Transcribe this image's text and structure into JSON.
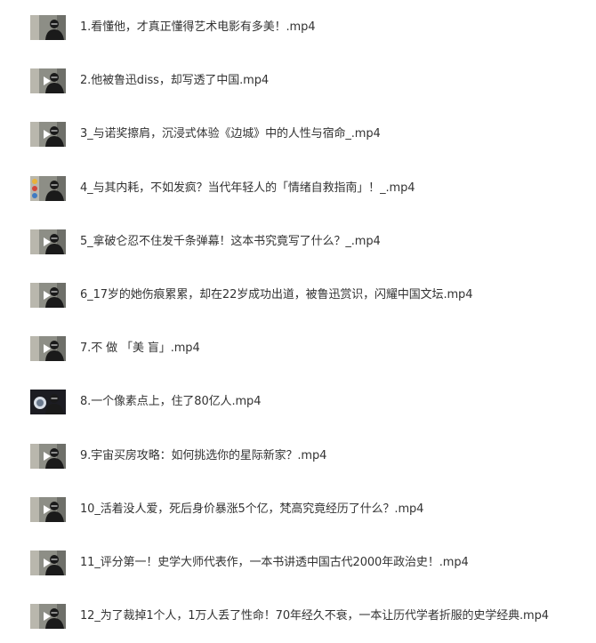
{
  "files": [
    {
      "name": "1.看懂他，才真正懂得艺术电影有多美！.mp4",
      "thumb_style": "standard",
      "has_play_icon": false
    },
    {
      "name": "2.他被鲁迅diss，却写透了中国.mp4",
      "thumb_style": "standard",
      "has_play_icon": true
    },
    {
      "name": "3_与诺奖擦肩，沉浸式体验《边城》中的人性与宿命_.mp4",
      "thumb_style": "standard",
      "has_play_icon": true
    },
    {
      "name": "4_与其内耗，不如发疯？当代年轻人的「情绪自救指南」！_.mp4",
      "thumb_style": "colorful",
      "has_play_icon": false
    },
    {
      "name": "5_拿破仑忍不住发千条弹幕！这本书究竟写了什么？_.mp4",
      "thumb_style": "standard",
      "has_play_icon": true
    },
    {
      "name": "6_17岁的她伤痕累累，却在22岁成功出道，被鲁迅赏识，闪耀中国文坛.mp4",
      "thumb_style": "standard",
      "has_play_icon": true
    },
    {
      "name": "7.不 做 「美 盲」.mp4",
      "thumb_style": "standard",
      "has_play_icon": true
    },
    {
      "name": "8.一个像素点上，住了80亿人.mp4",
      "thumb_style": "dark",
      "has_play_icon": false
    },
    {
      "name": "9.宇宙买房攻略：如何挑选你的星际新家？.mp4",
      "thumb_style": "standard",
      "has_play_icon": true
    },
    {
      "name": "10_活着没人爱，死后身价暴涨5个亿，梵高究竟经历了什么？.mp4",
      "thumb_style": "standard",
      "has_play_icon": true
    },
    {
      "name": "11_评分第一！史学大师代表作，一本书讲透中国古代2000年政治史！.mp4",
      "thumb_style": "standard",
      "has_play_icon": true
    },
    {
      "name": "12_为了裁掉1个人，1万人丢了性命！70年经久不衰，一本让历代学者折服的史学经典.mp4",
      "thumb_style": "standard",
      "has_play_icon": true
    }
  ],
  "colors": {
    "text": "#333333",
    "background": "#ffffff",
    "thumb_bg": "#8d8e86",
    "thumb_dark_bg": "#1c1c22",
    "presenter": "#1a1a1a"
  }
}
